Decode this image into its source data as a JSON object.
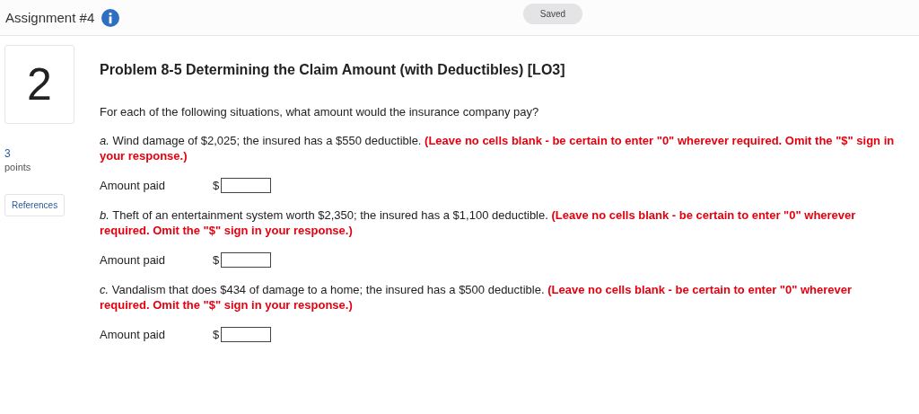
{
  "header": {
    "title": "Assignment #4",
    "status": "Saved"
  },
  "question": {
    "number": "2",
    "points": "3",
    "points_label": "points",
    "references": "References"
  },
  "problem": {
    "title": "Problem 8-5 Determining the Claim Amount (with Deductibles) [LO3]",
    "intro": "For each of the following situations, what amount would the insurance company pay?",
    "parts": [
      {
        "text": "*a.* Wind damage of $2,025; the insured has a $550 deductible. **(Leave no cells blank - be certain to enter \"0\" wherever required. Omit the \"$\" sign in your response.)**",
        "label": "Amount paid",
        "currency": "$"
      },
      {
        "text": "*b.* Theft of an entertainment system worth $2,350; the insured has a $1,100 deductible. **(Leave no cells blank - be certain to enter \"0\" wherever required. Omit the \"$\" sign in your response.)**",
        "label": "Amount paid",
        "currency": "$"
      },
      {
        "text": "*c.* Vandalism that does $434 of damage to a home; the insured has a $500 deductible. **(Leave no cells blank - be certain to enter \"0\" wherever required. Omit the \"$\" sign in your response.)**",
        "label": "Amount paid",
        "currency": "$"
      }
    ]
  }
}
